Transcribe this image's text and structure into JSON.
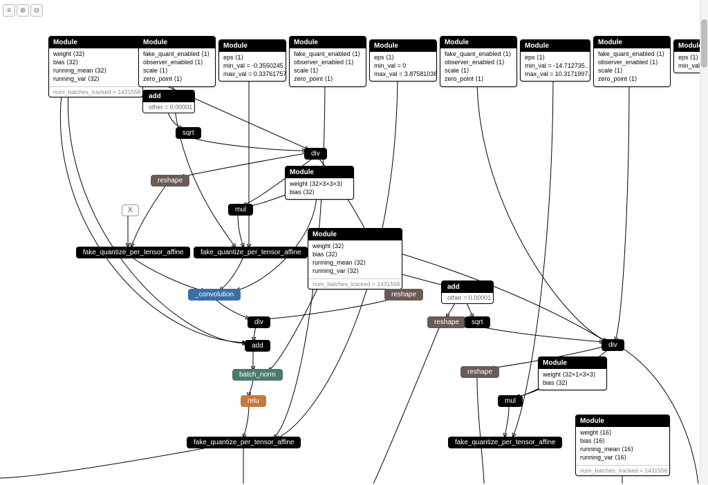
{
  "toolbar": {
    "list": "≡",
    "zoom_in": "⊕",
    "zoom_out": "⊖"
  },
  "labels": {
    "module": "Module",
    "x": "X"
  },
  "modules": {
    "m1": {
      "rows": [
        "weight  ⟨32⟩",
        "bias  ⟨32⟩",
        "running_mean  ⟨32⟩",
        "running_var  ⟨32⟩"
      ],
      "foot": "num_batches_tracked = 1431556"
    },
    "m2": {
      "rows": [
        "fake_quant_enabled  ⟨1⟩",
        "observer_enabled  ⟨1⟩",
        "scale  ⟨1⟩",
        "zero_point  ⟨1⟩"
      ]
    },
    "m3": {
      "rows": [
        "eps  ⟨1⟩",
        "min_val = -0.3550245…",
        "max_val = 0.33761757…"
      ]
    },
    "m4": {
      "rows": [
        "fake_quant_enabled  ⟨1⟩",
        "observer_enabled  ⟨1⟩",
        "scale  ⟨1⟩",
        "zero_point  ⟨1⟩"
      ]
    },
    "m5": {
      "rows": [
        "eps  ⟨1⟩",
        "min_val = 0",
        "max_val = 3.87581038…"
      ]
    },
    "m6": {
      "rows": [
        "fake_quant_enabled  ⟨1⟩",
        "observer_enabled  ⟨1⟩",
        "scale  ⟨1⟩",
        "zero_point  ⟨1⟩"
      ]
    },
    "m7": {
      "rows": [
        "eps  ⟨1⟩",
        "min_val = -14.712735…",
        "max_val = 10.3171997…"
      ]
    },
    "m8": {
      "rows": [
        "fake_quant_enabled  ⟨1⟩",
        "observer_enabled  ⟨1⟩",
        "scale  ⟨1⟩",
        "zero_point  ⟨1⟩"
      ]
    },
    "m9": {
      "rows": [
        "eps  ⟨1⟩",
        "min_val ="
      ]
    },
    "mw1": {
      "rows": [
        "weight  ⟨32×3×3×3⟩",
        "bias  ⟨32⟩"
      ]
    },
    "mbn": {
      "rows": [
        "weight  ⟨32⟩",
        "bias  ⟨32⟩",
        "running_mean  ⟨32⟩",
        "running_var  ⟨32⟩"
      ],
      "foot": "num_batches_tracked = 1431556"
    },
    "mw2": {
      "rows": [
        "weight  ⟨32×1×3×3⟩",
        "bias  ⟨32⟩"
      ]
    },
    "mbn2": {
      "rows": [
        "weight  ⟨16⟩",
        "bias  ⟨16⟩",
        "running_mean  ⟨16⟩",
        "running_var  ⟨16⟩"
      ],
      "foot": "num_batches_tracked = 1431556"
    }
  },
  "ops": {
    "add1": {
      "hdr": "add",
      "body": "other = 0.00001"
    },
    "sqrt1": "sqrt",
    "div1": "div",
    "reshape1": "reshape",
    "mul1": "mul",
    "fq1": "fake_quantize_per_tensor_affine",
    "fq2": "fake_quantize_per_tensor_affine",
    "conv": "_convolution",
    "reshape2": "reshape",
    "div2": "div",
    "add2": "add",
    "batchnorm": "batch_norm",
    "relu": "relu",
    "fq3": "fake_quantize_per_tensor_affine",
    "add3": {
      "hdr": "add",
      "body": "other = 0.00001"
    },
    "reshape3": "reshape",
    "sqrt2": "sqrt",
    "div3": "div",
    "reshape4": "reshape",
    "mul2": "mul",
    "fq4": "fake_quantize_per_tensor_affine"
  }
}
